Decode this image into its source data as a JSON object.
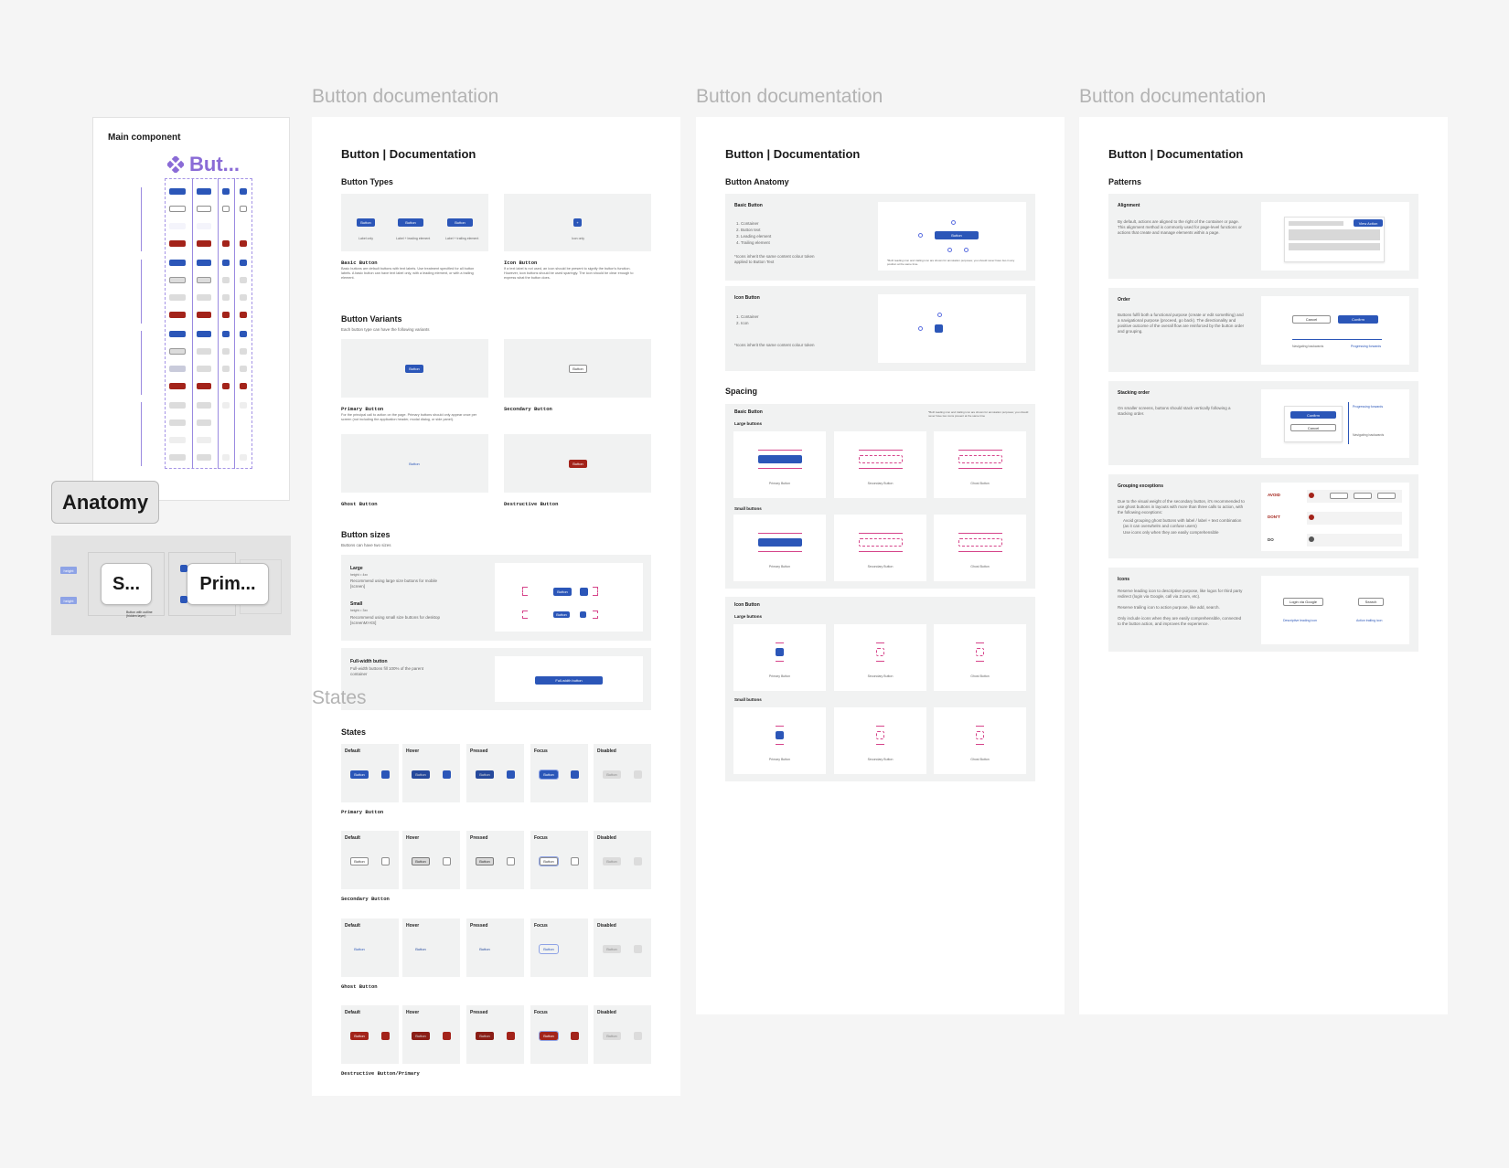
{
  "frames": {
    "doc1_title": "Button documentation",
    "doc2_title": "Button documentation",
    "doc3_title": "Button documentation",
    "states_title": "States"
  },
  "left": {
    "main_component_label": "Main component",
    "component_title": "But...",
    "anatomy_label": "Anatomy",
    "anatomy_tag_small": "S...",
    "anatomy_tag_primary": "Prim...",
    "height_tag_1": "height",
    "height_tag_2": "height",
    "caption": "Button with outline (hidden layer)"
  },
  "doc1": {
    "title": "Button | Documentation",
    "types_heading": "Button Types",
    "basic_label": "Basic Button",
    "basic_desc": "Basic buttons are default buttons with text labels. Use treatment specified for all button labels. A basic button can have text label only, with a leading element, or with a trailing element.",
    "icon_label": "Icon Button",
    "icon_desc": "If a text label is not used, an icon should be present to signify the button's function. However, icon buttons should be used sparingly. The icon should be clear enough to express what the button does.",
    "type_captions": [
      "Label only",
      "Label + leading element",
      "Label + trailing element",
      "Icon only"
    ],
    "button_text": "Button",
    "variants_heading": "Button Variants",
    "variants_sub": "Each button type can have the following variants",
    "primary_label": "Primary Button",
    "primary_desc": "For the principal call to action on the page. Primary buttons should only appear once per screen (not including the application header, modal dialog, or side panel).",
    "secondary_label": "Secondary Button",
    "ghost_label": "Ghost Button",
    "destructive_label": "Destructive Button",
    "sizes_heading": "Button sizes",
    "sizes_sub": "Buttons can have two sizes",
    "large_label": "Large",
    "large_height": "height = 4xx",
    "large_desc": "Recommend using large size buttons for mobile [screen]",
    "small_label": "Small",
    "small_height": "height = 3xx",
    "small_desc": "Recommend using small size buttons for desktop [screenM>XS]",
    "fullwidth_label": "Full-width button",
    "fullwidth_desc": "Full-width buttons fill 100% of the parent container",
    "fullwidth_button": "Full-width button",
    "states_heading": "States",
    "state_names": [
      "Default",
      "Hover",
      "Pressed",
      "Focus",
      "Disabled"
    ],
    "state_rows": [
      "Primary Button",
      "Secondary Button",
      "Ghost Button",
      "Destructive Button/Primary"
    ]
  },
  "doc2": {
    "title": "Button | Documentation",
    "anatomy_heading": "Button Anatomy",
    "basic_label": "Basic Button",
    "basic_items": [
      "1. Container",
      "2. Button text",
      "3. Leading element",
      "4. Trailing element"
    ],
    "basic_note": "*Icons inherit the same content colour token applied to Button Text",
    "basic_foot": "*Both leading icon and trailing icon are shown for annotation purposes; you should never have two in any position at the same time.",
    "icon_label": "Icon Button",
    "icon_items": [
      "1. Container",
      "2. Icon"
    ],
    "icon_note": "*Icons inherit the same content colour token",
    "spacing_heading": "Spacing",
    "spacing_basic": "Basic Button",
    "spacing_note": "*Both leading icon and trailing icon are shown for annotation purposes; you should never have two icons present at the same time",
    "large_buttons": "Large buttons",
    "small_buttons": "Small buttons",
    "icon_button": "Icon Button",
    "variant_captions": [
      "Primary Button",
      "Secondary Button",
      "Ghost Button"
    ]
  },
  "doc3": {
    "title": "Button | Documentation",
    "patterns_heading": "Patterns",
    "alignment_label": "Alignment",
    "alignment_desc": "By default, actions are aligned to the right of the container or page. This alignment method is commonly used for page-level functions or actions that create and manage elements within a page.",
    "order_label": "Order",
    "order_desc": "Buttons fulfil both a functional purpose (create or edit something) and a navigational purpose (proceed, go back). The directionality and positive outcome of the overall flow are reinforced by the button order and grouping.",
    "order_cancel": "Cancel",
    "order_confirm": "Confirm",
    "order_back": "Navigating backwards",
    "order_forward": "Progressing forwards",
    "stacking_label": "Stacking order",
    "stacking_desc": "On smaller screens, buttons should stack vertically following a stacking order.",
    "grouping_label": "Grouping exceptions",
    "grouping_desc": "Due to the visual weight of the secondary button, it's recommended to use ghost buttons in layouts with more than three calls to action, with the following exceptions:",
    "grouping_bullets": [
      "Avoid grouping ghost buttons with label / label + text combination (as it can overwhelm and confuse users)",
      "Use icons only when they are easily comprehensible"
    ],
    "avoid": "AVOID",
    "dont": "DON'T",
    "do": "DO",
    "icons_label": "Icons",
    "icons_desc1": "Reserve leading icon to descriptive purpose, like logos for third party redirect (login via Google, call via Zoom, etc).",
    "icons_desc2": "Reserve trailing icon to action purpose, like add, search.",
    "icons_desc3": "Only include icons when they are easily comprehensible, connected to the button action, and improves the experience.",
    "login_google": "Login via Google",
    "search": "Search",
    "leading_caption": "Descriptive leading icon",
    "trailing_caption": "Action trailing icon",
    "view_btn": "View Action"
  },
  "colors": {
    "primary": "#2b56b8",
    "destructive": "#a3231a",
    "canvas": "#f5f5f5",
    "panel": "#f1f2f2",
    "annotation": "#d6448a",
    "component": "#8a6bd6"
  }
}
